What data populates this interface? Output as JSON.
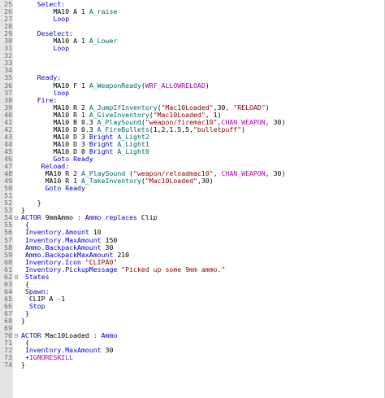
{
  "editor": {
    "colors": {
      "gutter_bg": "#e4e4e4",
      "line_number": "#6b6b6b",
      "keyword": "#0000cc",
      "string": "#880000",
      "function": "#006666",
      "flag": "#b000b0",
      "plain": "#000000"
    },
    "lines": [
      {
        "n": "25",
        "fold": "",
        "indent": "    ",
        "tokens": [
          [
            "kw",
            "Select:"
          ]
        ]
      },
      {
        "n": "26",
        "fold": "",
        "indent": "        ",
        "tokens": [
          [
            "plain",
            "MA10 A 1 "
          ],
          [
            "func",
            "A_raise"
          ]
        ]
      },
      {
        "n": "27",
        "fold": "",
        "indent": "        ",
        "tokens": [
          [
            "kw",
            "Loop"
          ]
        ]
      },
      {
        "n": "28",
        "fold": "",
        "indent": "",
        "tokens": []
      },
      {
        "n": "29",
        "fold": "",
        "indent": "    ",
        "tokens": [
          [
            "kw",
            "Deselect:"
          ]
        ]
      },
      {
        "n": "30",
        "fold": "",
        "indent": "        ",
        "tokens": [
          [
            "plain",
            "MA10 A 1 "
          ],
          [
            "func",
            "A_Lower"
          ]
        ]
      },
      {
        "n": "31",
        "fold": "",
        "indent": "        ",
        "tokens": [
          [
            "kw",
            "Loop"
          ]
        ]
      },
      {
        "n": "32",
        "fold": "",
        "indent": "",
        "tokens": []
      },
      {
        "n": "33",
        "fold": "",
        "indent": "",
        "tokens": []
      },
      {
        "n": "34",
        "fold": "",
        "indent": "",
        "tokens": []
      },
      {
        "n": "35",
        "fold": "",
        "indent": "    ",
        "tokens": [
          [
            "kw",
            "Ready:"
          ]
        ]
      },
      {
        "n": "36",
        "fold": "",
        "indent": "        ",
        "tokens": [
          [
            "plain",
            "MA10 F 1 "
          ],
          [
            "func",
            "A_WeaponReady"
          ],
          [
            "plain",
            "("
          ],
          [
            "flag",
            "WRF_ALLOWRELOAD"
          ],
          [
            "plain",
            ")"
          ]
        ]
      },
      {
        "n": "37",
        "fold": "",
        "indent": "        ",
        "tokens": [
          [
            "kw",
            "loop"
          ]
        ]
      },
      {
        "n": "38",
        "fold": "",
        "indent": "    ",
        "tokens": [
          [
            "kw",
            "Fire:"
          ]
        ]
      },
      {
        "n": "39",
        "fold": "",
        "indent": "        ",
        "tokens": [
          [
            "plain",
            "MA10 R 2 "
          ],
          [
            "func",
            "A_JumpIfInventory"
          ],
          [
            "plain",
            "("
          ],
          [
            "str",
            "\"Mac10Loaded\""
          ],
          [
            "plain",
            ",30, "
          ],
          [
            "str",
            "\"RELOAD\""
          ],
          [
            "plain",
            ")"
          ]
        ]
      },
      {
        "n": "40",
        "fold": "",
        "indent": "        ",
        "tokens": [
          [
            "plain",
            "MA10 R 1 "
          ],
          [
            "func",
            "A_GiveInventory"
          ],
          [
            "plain",
            "("
          ],
          [
            "str",
            "\"Mac10Loaded\""
          ],
          [
            "plain",
            ", 1)"
          ]
        ]
      },
      {
        "n": "41",
        "fold": "",
        "indent": "        ",
        "tokens": [
          [
            "plain",
            "MA10 B 0.3 "
          ],
          [
            "func",
            "A_PlaySound"
          ],
          [
            "plain",
            "("
          ],
          [
            "str",
            "\"weapon/firemac10\""
          ],
          [
            "plain",
            ","
          ],
          [
            "flag",
            "CHAN_WEAPON"
          ],
          [
            "plain",
            ", 30)"
          ]
        ]
      },
      {
        "n": "42",
        "fold": "",
        "indent": "        ",
        "tokens": [
          [
            "plain",
            "MA10 D 0.3 "
          ],
          [
            "func",
            "A_FireBullets"
          ],
          [
            "plain",
            "(1,2,1.5,5,"
          ],
          [
            "str",
            "\"bulletpuff\""
          ],
          [
            "plain",
            ")"
          ]
        ]
      },
      {
        "n": "43",
        "fold": "",
        "indent": "        ",
        "tokens": [
          [
            "plain",
            "MA10 D 3 "
          ],
          [
            "kw",
            "Bright "
          ],
          [
            "func",
            "A_Light2"
          ]
        ]
      },
      {
        "n": "44",
        "fold": "",
        "indent": "        ",
        "tokens": [
          [
            "plain",
            "MA10 D 3 "
          ],
          [
            "kw",
            "Bright "
          ],
          [
            "func",
            "A_Light1"
          ]
        ]
      },
      {
        "n": "45",
        "fold": "",
        "indent": "        ",
        "tokens": [
          [
            "plain",
            "MA10 D 0 "
          ],
          [
            "kw",
            "Bright "
          ],
          [
            "func",
            "A_Light0"
          ]
        ]
      },
      {
        "n": "46",
        "fold": "",
        "indent": "        ",
        "tokens": [
          [
            "kw",
            "Goto Ready"
          ]
        ]
      },
      {
        "n": "47",
        "fold": "",
        "indent": "     ",
        "tokens": [
          [
            "kw",
            "Reload:"
          ]
        ]
      },
      {
        "n": "48",
        "fold": "",
        "indent": "      ",
        "tokens": [
          [
            "plain",
            "MA10 R 2 "
          ],
          [
            "func",
            "A_PlaySound"
          ],
          [
            "plain",
            " ("
          ],
          [
            "str",
            "\"weapon/reloadmac10\""
          ],
          [
            "plain",
            ", "
          ],
          [
            "flag",
            "CHAN_WEAPON"
          ],
          [
            "plain",
            ", 30)"
          ]
        ]
      },
      {
        "n": "49",
        "fold": "",
        "indent": "      ",
        "tokens": [
          [
            "plain",
            "MA10 R 1 "
          ],
          [
            "func",
            "A_TakeInventory"
          ],
          [
            "plain",
            "("
          ],
          [
            "str",
            "\"Mac10Loaded\""
          ],
          [
            "plain",
            ",30)"
          ]
        ]
      },
      {
        "n": "50",
        "fold": "",
        "indent": "      ",
        "tokens": [
          [
            "kw",
            "Goto Ready"
          ]
        ]
      },
      {
        "n": "51",
        "fold": "",
        "indent": "",
        "tokens": []
      },
      {
        "n": "52",
        "fold": "",
        "indent": "    ",
        "tokens": [
          [
            "plain",
            "}"
          ]
        ]
      },
      {
        "n": "53",
        "fold": "",
        "indent": "",
        "tokens": [
          [
            "plain",
            "}"
          ]
        ]
      },
      {
        "n": "54",
        "fold": "⊟",
        "indent": "",
        "tokens": [
          [
            "kw",
            "ACTOR "
          ],
          [
            "plain",
            "9mmAmmo : "
          ],
          [
            "kw",
            "Ammo replaces "
          ],
          [
            "plain",
            "Clip"
          ]
        ]
      },
      {
        "n": "55",
        "fold": "",
        "indent": " ",
        "tokens": [
          [
            "plain",
            "{"
          ]
        ]
      },
      {
        "n": "56",
        "fold": "",
        "indent": " ",
        "tokens": [
          [
            "prop",
            "Inventory.Amount"
          ],
          [
            "plain",
            " 10"
          ]
        ]
      },
      {
        "n": "57",
        "fold": "",
        "indent": " ",
        "tokens": [
          [
            "prop",
            "Inventory.MaxAmount"
          ],
          [
            "plain",
            " 150"
          ]
        ]
      },
      {
        "n": "58",
        "fold": "",
        "indent": " ",
        "tokens": [
          [
            "prop",
            "Ammo.BackpackAmount"
          ],
          [
            "plain",
            " 30"
          ]
        ]
      },
      {
        "n": "59",
        "fold": "",
        "indent": " ",
        "tokens": [
          [
            "prop",
            "Ammo.BackpackMaxAmount"
          ],
          [
            "plain",
            " 210"
          ]
        ]
      },
      {
        "n": "60",
        "fold": "",
        "indent": " ",
        "tokens": [
          [
            "prop",
            "Inventory.Icon"
          ],
          [
            "plain",
            " "
          ],
          [
            "str",
            "\"CLIPA0\""
          ]
        ]
      },
      {
        "n": "61",
        "fold": "",
        "indent": " ",
        "tokens": [
          [
            "prop",
            "Inventory.PickupMessage"
          ],
          [
            "plain",
            " "
          ],
          [
            "str",
            "\"Picked up some 9mm ammo.\""
          ]
        ]
      },
      {
        "n": "62",
        "fold": "⊟",
        "indent": " ",
        "tokens": [
          [
            "kw",
            "States"
          ]
        ]
      },
      {
        "n": "63",
        "fold": "",
        "indent": " ",
        "tokens": [
          [
            "plain",
            "{"
          ]
        ]
      },
      {
        "n": "64",
        "fold": "",
        "indent": " ",
        "tokens": [
          [
            "kw",
            "Spawn:"
          ]
        ]
      },
      {
        "n": "65",
        "fold": "",
        "indent": "  ",
        "tokens": [
          [
            "plain",
            "CLIP A -1"
          ]
        ]
      },
      {
        "n": "66",
        "fold": "",
        "indent": "  ",
        "tokens": [
          [
            "kw",
            "Stop"
          ]
        ]
      },
      {
        "n": "67",
        "fold": "",
        "indent": " ",
        "tokens": [
          [
            "plain",
            "}"
          ]
        ]
      },
      {
        "n": "68",
        "fold": "",
        "indent": "",
        "tokens": [
          [
            "plain",
            "}"
          ]
        ]
      },
      {
        "n": "69",
        "fold": "",
        "indent": "",
        "tokens": []
      },
      {
        "n": "70",
        "fold": "⊟",
        "indent": "",
        "tokens": [
          [
            "kw",
            "ACTOR "
          ],
          [
            "plain",
            "Mac10Loaded : "
          ],
          [
            "kw",
            "Ammo"
          ]
        ]
      },
      {
        "n": "71",
        "fold": "",
        "indent": " ",
        "tokens": [
          [
            "plain",
            "{"
          ]
        ]
      },
      {
        "n": "72",
        "fold": "",
        "indent": " ",
        "tokens": [
          [
            "prop",
            "Inventory.MaxAmount"
          ],
          [
            "plain",
            " 30"
          ]
        ]
      },
      {
        "n": "73",
        "fold": "",
        "indent": " ",
        "tokens": [
          [
            "plain",
            "+"
          ],
          [
            "flag",
            "IGNORESKILL"
          ]
        ]
      },
      {
        "n": "74",
        "fold": "",
        "indent": "",
        "tokens": [
          [
            "plain",
            "}"
          ]
        ]
      }
    ]
  }
}
